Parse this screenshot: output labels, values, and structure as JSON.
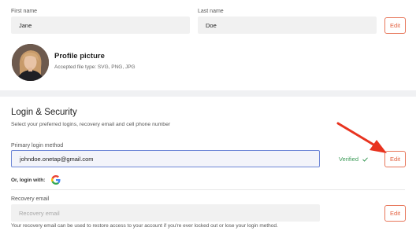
{
  "name_section": {
    "first_name_label": "First name",
    "first_name_value": "Jane",
    "last_name_label": "Last name",
    "last_name_value": "Doe",
    "edit_label": "Edit"
  },
  "profile": {
    "title": "Profile picture",
    "accepted": "Accepted file type: SVG, PNG, JPG"
  },
  "login_security": {
    "title": "Login & Security",
    "subtitle": "Select your preferred logins, recovery email and cell phone number",
    "primary_label": "Primary login method",
    "primary_value": "johndoe.onetap@gmail.com",
    "verified_text": "Verified",
    "edit_label": "Edit",
    "or_login_with": "Or, login with:",
    "recovery_label": "Recovery email",
    "recovery_placeholder": "Recovery email",
    "recovery_edit_label": "Edit",
    "recovery_help": "Your recovery email can be used to restore access to your account if you're ever locked out or lose your login method."
  },
  "icons": {
    "verified": "check-icon",
    "google": "google-icon",
    "annotation": "red-arrow"
  },
  "colors": {
    "accent": "#e25f3e",
    "verified": "#3b9a57",
    "focus_border": "#6d86d6",
    "arrow": "#e8331f"
  }
}
